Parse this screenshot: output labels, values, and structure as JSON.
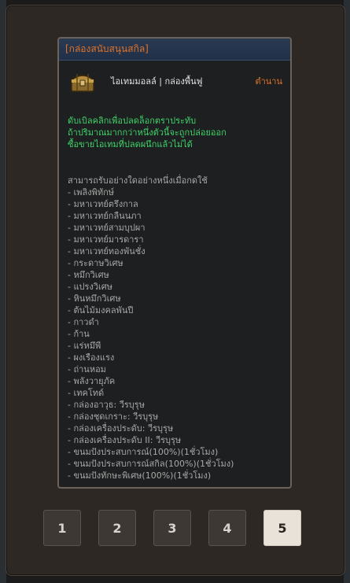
{
  "tooltip": {
    "header": "[กล่องสนับสนุนสกิล]",
    "item_name": "ไอเทมมอลล์ | กล่องพื้นฟู",
    "item_grade": "ตำนาน",
    "description": [
      "ดับเบิลคลิกเพื่อปลดล็อกตราประทับ",
      "ถ้าปริมาณมากกว่าหนึ่งตัวนี้จะถูกปล่อยออก",
      "ซื้อขายไอเทมที่ปลดผนึกแล้วไม่ได้"
    ],
    "uses_title": "สามารถรับอย่างใดอย่างหนึ่งเมื่อกดใช้",
    "uses": [
      "- เพลิงพิทักษ์",
      "- มหาเวทย์ตรึงกาล",
      "- มหาเวทย์กลืนนภา",
      "- มหาเวทย์สามบุปผา",
      "- มหาเวทย์มารดารา",
      "- มหาเวทย์ทองพันชั่ง",
      "- กระดาษวิเศษ",
      "- หมึกวิเศษ",
      "- แปรงวิเศษ",
      "- หินหมึกวิเศษ",
      "- ต้นไม้มงคลพันปี",
      "- กาวดำ",
      "- ก้าน",
      "- แร่หมึพี",
      "- ผงเรืองแรง",
      "- ถ่านหอม",
      "- พลังวายุภัค",
      "- เทคโทด์",
      "- กล่องอาวุธ: วีรบุรุษ",
      "- กล่องชุดเกราะ: วีรบุรุษ",
      "- กล่องเครื่องประดับ: วีรบุรุษ",
      "- กล่องเครื่องประดับ II: วีรบุรุษ",
      "- ขนมปังประสบการณ์(100%)(1ชั่วโมง)",
      "- ขนมปังประสบการณ์สกิล(100%)(1ชั่วโมง)",
      "- ขนมปังทักษะพิเศษ(100%)(1ชั่วโมง)"
    ]
  },
  "pager": {
    "pages": [
      "1",
      "2",
      "3",
      "4",
      "5"
    ],
    "active": "5"
  },
  "colors": {
    "accent_orange": "#e0732a",
    "description_green": "#3fd46a",
    "active_page_bg": "#e8e2d8"
  },
  "icons": {
    "item": "treasure-chest-icon"
  }
}
